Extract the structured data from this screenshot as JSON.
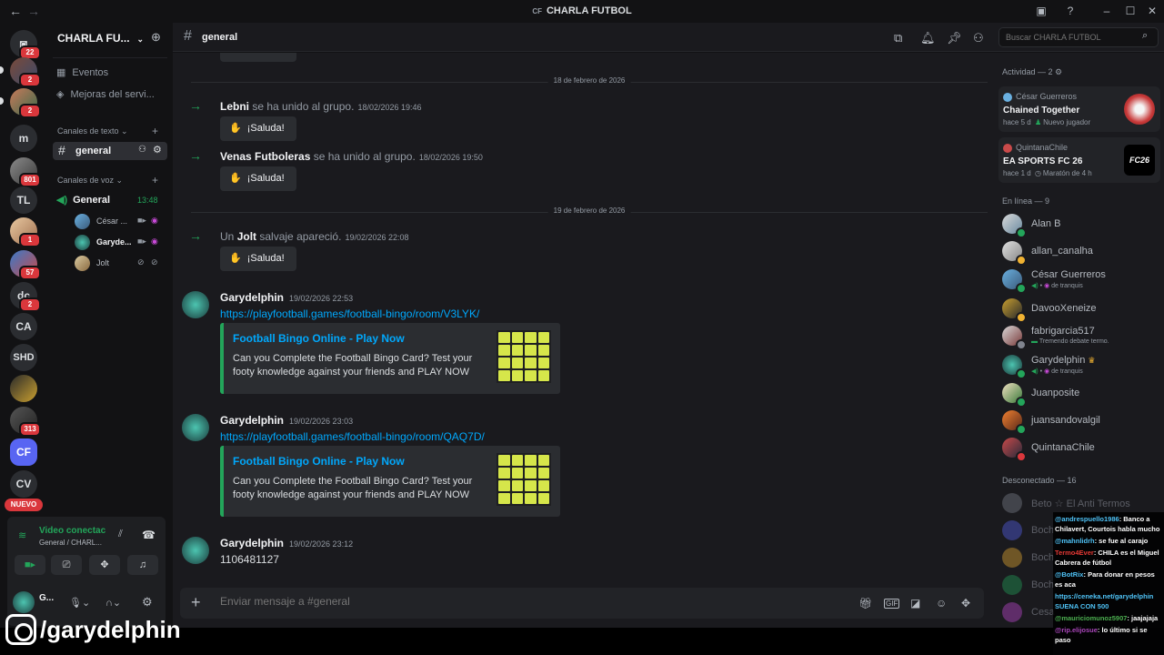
{
  "window": {
    "title": "CHARLA FUTBOL",
    "back": "←",
    "forward": "→"
  },
  "rail": {
    "servers": [
      {
        "label": "",
        "badge": "22"
      },
      {
        "label": "",
        "badge": "2"
      },
      {
        "label": "",
        "badge": "2"
      },
      {
        "label": "m",
        "badge": ""
      },
      {
        "label": "",
        "badge": "801"
      },
      {
        "label": "TL",
        "badge": ""
      },
      {
        "label": "",
        "badge": "1"
      },
      {
        "label": "",
        "badge": "57"
      },
      {
        "label": "dc",
        "badge": "2"
      },
      {
        "label": "CA",
        "badge": ""
      },
      {
        "label": "SHD",
        "badge": ""
      },
      {
        "label": "",
        "badge": ""
      },
      {
        "label": "",
        "badge": "313"
      },
      {
        "label": "CF",
        "badge": ""
      },
      {
        "label": "CV",
        "badge": ""
      }
    ],
    "new_badge": "NUEVO"
  },
  "sidebar": {
    "server_name": "CHARLA FU...",
    "events": "Eventos",
    "boosts": "Mejoras del servi...",
    "text_category": "Canales de texto",
    "text_channel": "general",
    "voice_category": "Canales de voz",
    "voice_channel": "General",
    "voice_timer": "13:48",
    "voice_users": [
      "César ...",
      "Garyde...",
      "Jolt"
    ]
  },
  "voice_panel": {
    "status": "Video conectac",
    "channel": "General / CHARL...",
    "user_short": "G..."
  },
  "header": {
    "channel": "general",
    "search_placeholder": "Buscar CHARLA FUTBOL"
  },
  "chat": {
    "date1": "18 de febrero de 2026",
    "date2": "19 de febrero de 2026",
    "joins": [
      {
        "prefix": "",
        "name": "Lebni",
        "text": "se ha unido al grupo.",
        "time": "18/02/2026 19:46",
        "button": "¡Saluda!"
      },
      {
        "prefix": "",
        "name": "Venas Futboleras",
        "text": "se ha unido al grupo.",
        "time": "18/02/2026 19:50",
        "button": "¡Saluda!"
      },
      {
        "prefix": "Un",
        "name": "Jolt",
        "text": "salvaje apareció.",
        "time": "19/02/2026 22:08",
        "button": "¡Saluda!"
      }
    ],
    "messages": [
      {
        "author": "Garydelphin",
        "time": "19/02/2026 22:53",
        "link": "https://playfootball.games/football-bingo/room/V3LYK/",
        "embed_title": "Football Bingo Online - Play Now",
        "embed_desc": "Can you Complete the Football Bingo Card? Test your footy knowledge against your friends and PLAY NOW"
      },
      {
        "author": "Garydelphin",
        "time": "19/02/2026 23:03",
        "link": "https://playfootball.games/football-bingo/room/QAQ7D/",
        "embed_title": "Football Bingo Online - Play Now",
        "embed_desc": "Can you Complete the Football Bingo Card? Test your footy knowledge against your friends and PLAY NOW"
      },
      {
        "author": "Garydelphin",
        "time": "19/02/2026 23:12",
        "text": "1106481127"
      }
    ],
    "composer_placeholder": "Enviar mensaje a #general"
  },
  "members": {
    "activity_header": "Actividad — 2",
    "activities": [
      {
        "user": "César Guerreros",
        "game": "Chained Together",
        "meta1": "hace 5 d",
        "meta2": "Nuevo jugador"
      },
      {
        "user": "QuintanaChile",
        "game": "EA SPORTS FC 26",
        "meta1": "hace 1 d",
        "meta2": "Maratón de 4 h"
      }
    ],
    "online_header": "En línea — 9",
    "online": [
      {
        "name": "Alan B",
        "sub": ""
      },
      {
        "name": "allan_canalha",
        "sub": ""
      },
      {
        "name": "César Guerreros",
        "sub": "de tranquis"
      },
      {
        "name": "DavooXeneize",
        "sub": ""
      },
      {
        "name": "fabrigarcia517",
        "sub": "Tremendo debate termo."
      },
      {
        "name": "Garydelphin",
        "sub": "de tranquis"
      },
      {
        "name": "Juanposite",
        "sub": ""
      },
      {
        "name": "juansandovalgil",
        "sub": ""
      },
      {
        "name": "QuintanaChile",
        "sub": ""
      }
    ],
    "offline_header": "Desconectado — 16",
    "offline": [
      "Beto ☆ El Anti Termos",
      "Boch",
      "Boch",
      "Boch",
      "Cesa"
    ]
  },
  "stream_chat": [
    {
      "user": "@andrespuello1986",
      "msg": ": Banco a Chilavert, Courtois habla mucho",
      "color": "#4fc3f7"
    },
    {
      "user": "@mahnlidrh",
      "msg": ": se fue al carajo",
      "color": "#4fc3f7"
    },
    {
      "user": "Termo4Ever",
      "msg": ": CHILA es el Miguel Cabrera de fútbol",
      "color": "#e53935"
    },
    {
      "user": "@BotRix",
      "msg": ": Para donar en pesos es aca",
      "color": "#4fc3f7"
    },
    {
      "user": "",
      "msg": "https://ceneka.net/garydelphin SUENA CON 500",
      "color": "#ffffff"
    },
    {
      "user": "@mauriciomunoz5907",
      "msg": ": jaajajaja",
      "color": "#4caf50"
    },
    {
      "user": "@rip.elijosue",
      "msg": ": lo último si se paso",
      "color": "#ab47bc"
    }
  ],
  "watermark": "/garydelphin"
}
